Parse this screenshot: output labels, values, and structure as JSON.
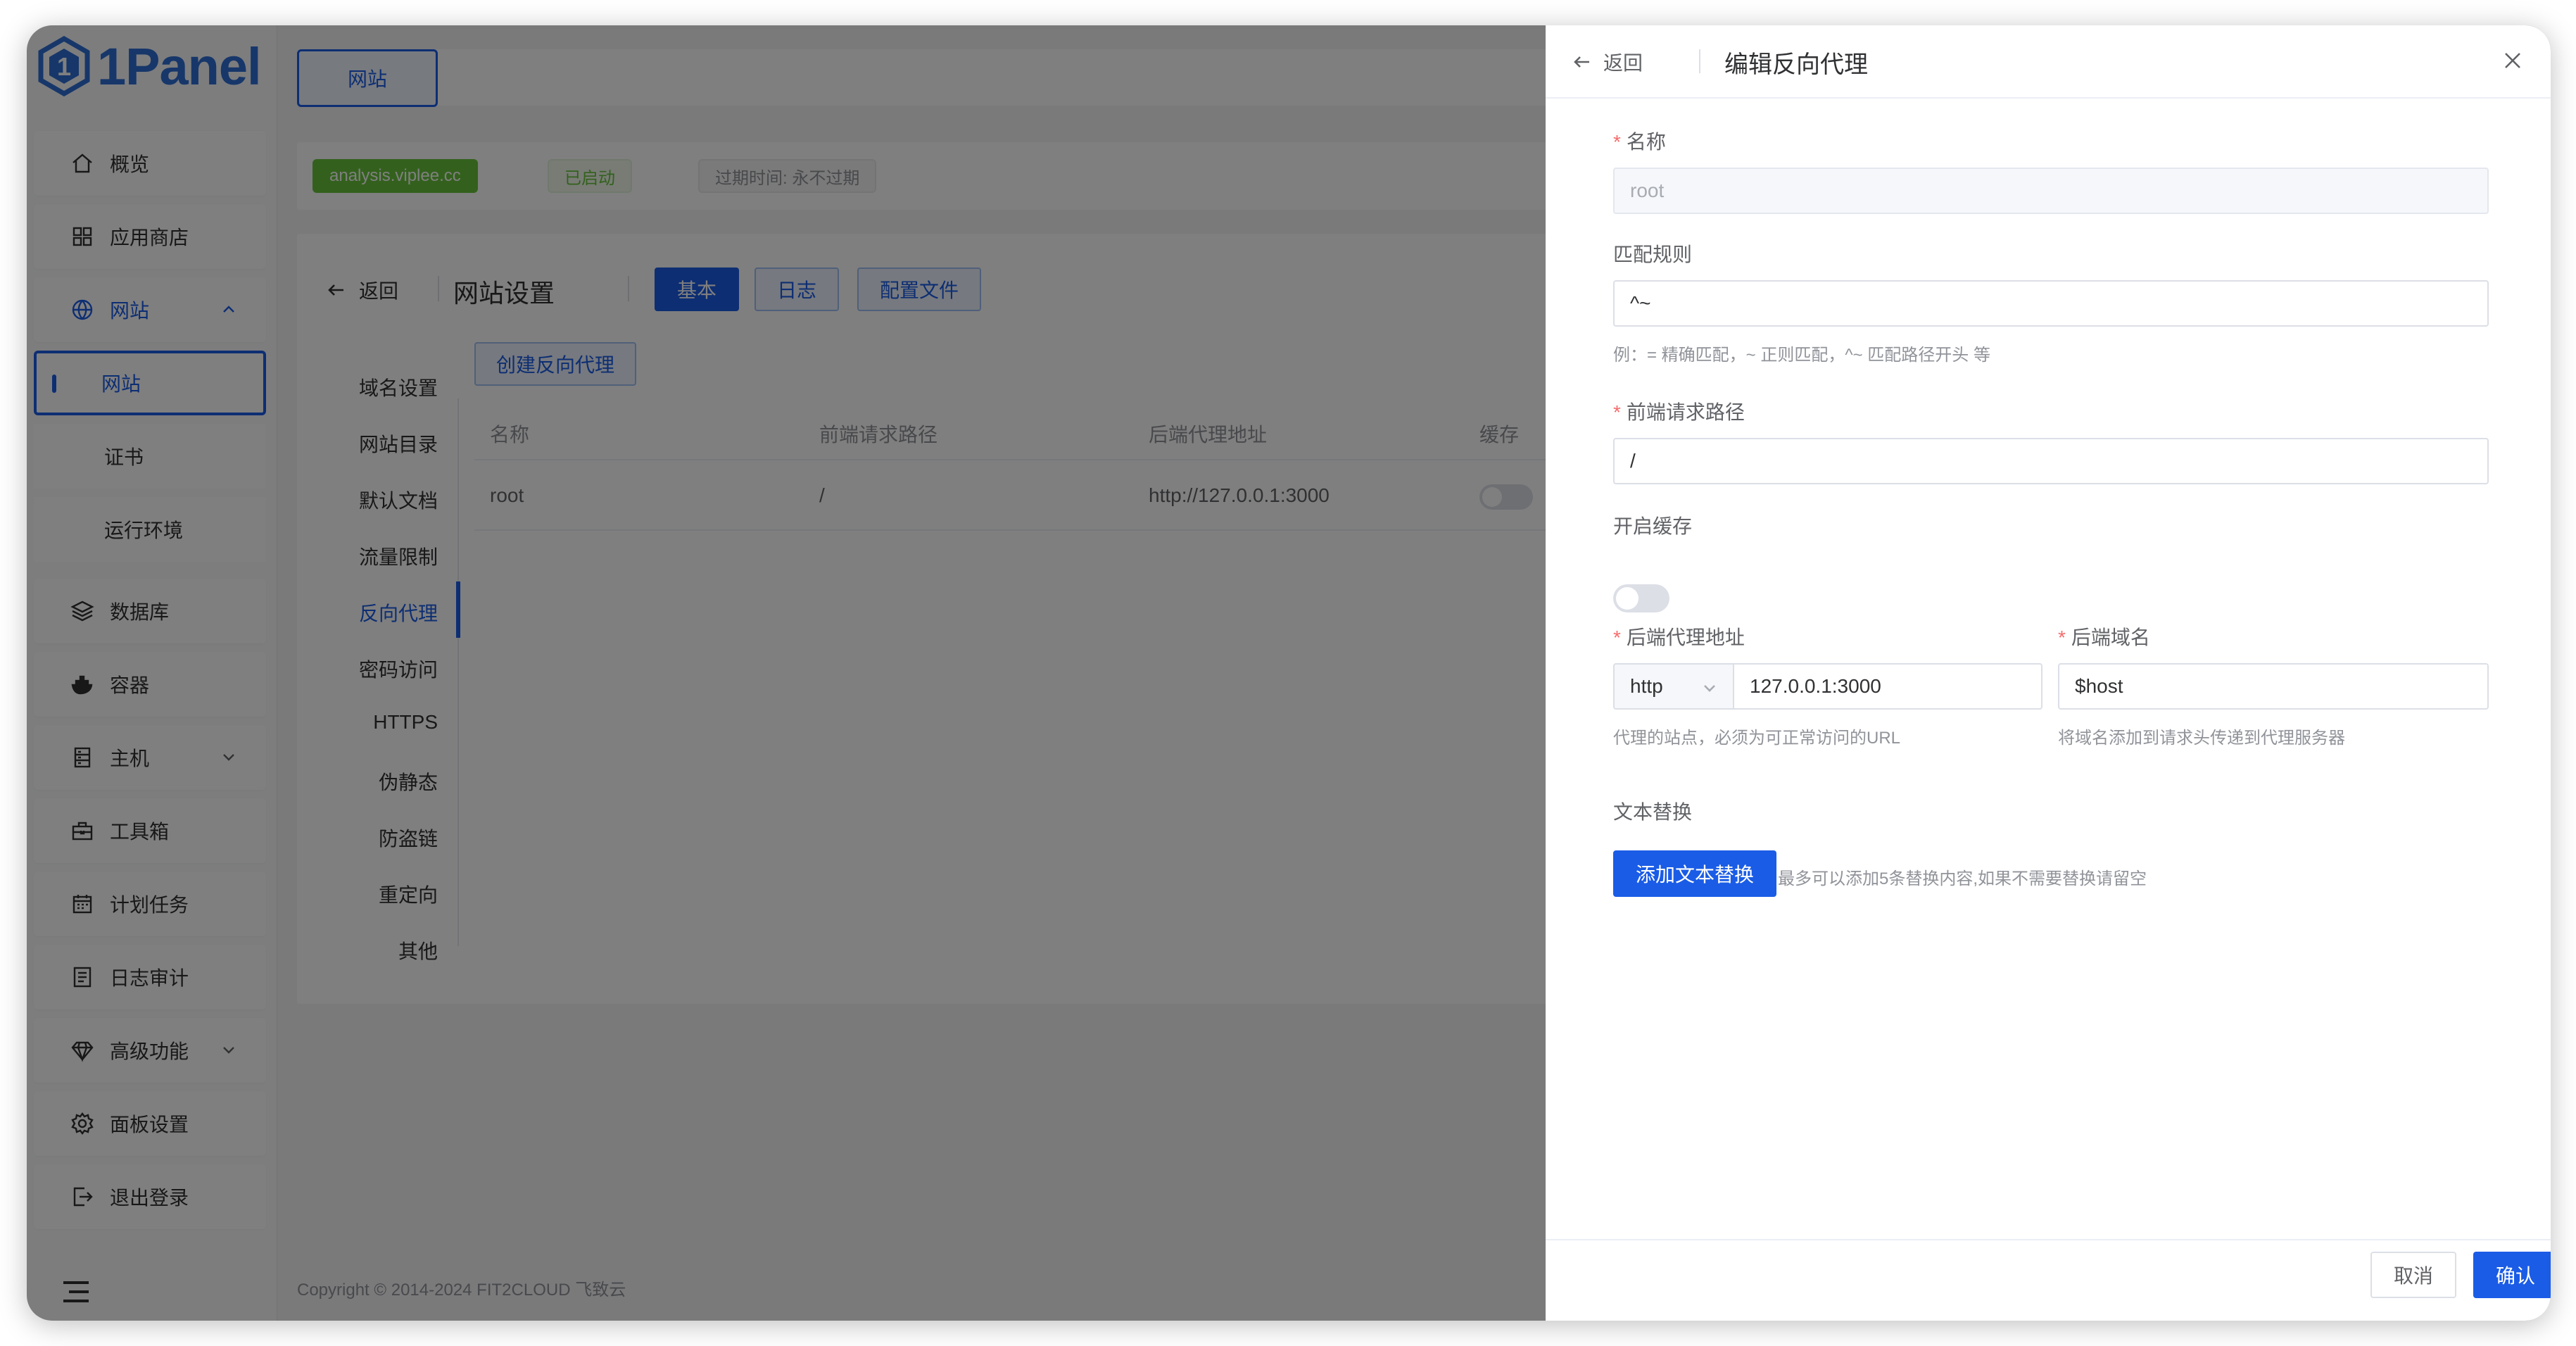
{
  "brand": {
    "logo_text": "1Panel",
    "accent": "#1a5ce6"
  },
  "sidebar": {
    "items": [
      {
        "label": "概览",
        "icon": "home-icon"
      },
      {
        "label": "应用商店",
        "icon": "grid-icon"
      },
      {
        "label": "网站",
        "icon": "globe-icon"
      },
      {
        "label": "数据库",
        "icon": "layers-icon"
      },
      {
        "label": "容器",
        "icon": "docker-icon"
      },
      {
        "label": "主机",
        "icon": "server-icon"
      },
      {
        "label": "工具箱",
        "icon": "toolbox-icon"
      },
      {
        "label": "计划任务",
        "icon": "calendar-icon"
      },
      {
        "label": "日志审计",
        "icon": "log-icon"
      },
      {
        "label": "高级功能",
        "icon": "diamond-icon"
      },
      {
        "label": "面板设置",
        "icon": "gear-icon"
      },
      {
        "label": "退出登录",
        "icon": "logout-icon"
      }
    ],
    "website_sub": [
      "网站",
      "证书",
      "运行环境"
    ]
  },
  "topbar": {
    "tab": "网站"
  },
  "infobar": {
    "site": "analysis.viplee.cc",
    "status": "已启动",
    "expire": "过期时间: 永不过期"
  },
  "card": {
    "back": "返回",
    "title": "网站设置",
    "tabs": [
      "基本",
      "日志",
      "配置文件"
    ],
    "create_button": "创建反向代理",
    "menu": [
      "域名设置",
      "网站目录",
      "默认文档",
      "流量限制",
      "反向代理",
      "密码访问",
      "HTTPS",
      "伪静态",
      "防盗链",
      "重定向",
      "其他"
    ],
    "table": {
      "headers": [
        "名称",
        "前端请求路径",
        "后端代理地址",
        "缓存"
      ],
      "rows": [
        {
          "name": "root",
          "path": "/",
          "backend": "http://127.0.0.1:3000"
        }
      ]
    }
  },
  "footer": {
    "copyright": "Copyright © 2014-2024 FIT2CLOUD 飞致云"
  },
  "drawer": {
    "back": "返回",
    "title": "编辑反向代理",
    "name_label": "名称",
    "name_value": "root",
    "match_label": "匹配规则",
    "match_value": "^~",
    "match_hint": "例：= 精确匹配，~ 正则匹配，^~ 匹配路径开头 等",
    "path_label": "前端请求路径",
    "path_value": "/",
    "cache_label": "开启缓存",
    "backend_label": "后端代理地址",
    "protocol": "http",
    "backend_value": "127.0.0.1:3000",
    "backend_hint": "代理的站点，必须为可正常访问的URL",
    "host_label": "后端域名",
    "host_value": "$host",
    "host_hint": "将域名添加到请求头传递到代理服务器",
    "replace_label": "文本替换",
    "replace_button": "添加文本替换",
    "replace_hint": "最多可以添加5条替换内容,如果不需要替换请留空",
    "cancel": "取消",
    "confirm": "确认"
  }
}
